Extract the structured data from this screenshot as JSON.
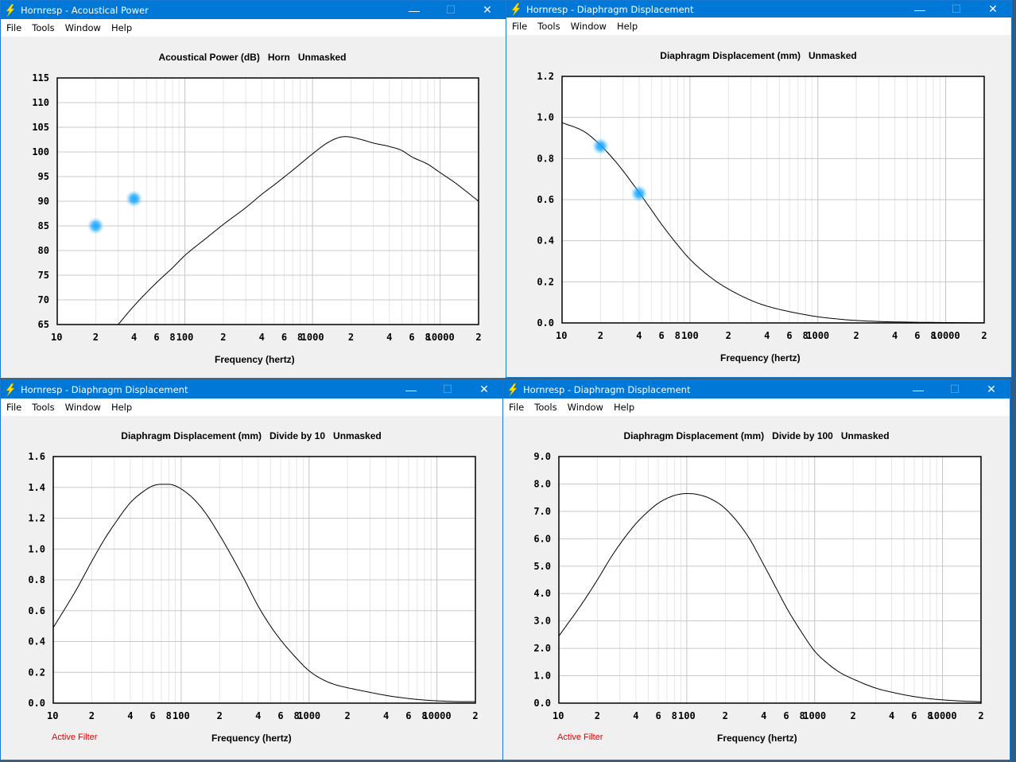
{
  "menu": [
    "File",
    "Tools",
    "Window",
    "Help"
  ],
  "window_controls": {
    "minimize": "—",
    "maximize": "☐",
    "close": "✕"
  },
  "windows": [
    {
      "title": "Hornresp - Acoustical Power",
      "chart_title": "Acoustical Power (dB)   Horn   Unmasked",
      "xlabel": "Frequency (hertz)",
      "footer_note": ""
    },
    {
      "title": "Hornresp - Diaphragm Displacement",
      "chart_title": "Diaphragm Displacement (mm)   Unmasked",
      "xlabel": "Frequency (hertz)",
      "footer_note": ""
    },
    {
      "title": "Hornresp - Diaphragm Displacement",
      "chart_title": "Diaphragm Displacement (mm)   Divide by 10   Unmasked",
      "xlabel": "Frequency (hertz)",
      "footer_note": "Active Filter"
    },
    {
      "title": "Hornresp - Diaphragm Displacement",
      "chart_title": "Diaphragm Displacement (mm)   Divide by 100   Unmasked",
      "xlabel": "Frequency (hertz)",
      "footer_note": "Active Filter"
    }
  ],
  "colors": {
    "titlebar": "#0078d7",
    "curve": "#000000",
    "grid": "#c8c8c8",
    "active_filter": "#e00000",
    "marker": "#1aa7ff"
  },
  "chart_data": [
    {
      "type": "line",
      "title": "Acoustical Power (dB)   Horn   Unmasked",
      "xlabel": "Frequency (hertz)",
      "ylabel": "",
      "xscale": "log",
      "xlim": [
        10,
        20000
      ],
      "ylim": [
        65,
        115
      ],
      "xticks": [
        10,
        20,
        40,
        60,
        80,
        100,
        200,
        400,
        600,
        800,
        1000,
        2000,
        4000,
        6000,
        8000,
        10000,
        20000
      ],
      "xtick_labels": [
        "10",
        "2",
        "4",
        "6",
        "8",
        "100",
        "2",
        "4",
        "6",
        "8",
        "1000",
        "2",
        "4",
        "6",
        "8",
        "10000",
        "2"
      ],
      "yticks": [
        65,
        70,
        75,
        80,
        85,
        90,
        95,
        100,
        105,
        110,
        115
      ],
      "ytick_labels": [
        "65",
        "70",
        "75",
        "80",
        "85",
        "90",
        "95",
        "100",
        "105",
        "110",
        "115"
      ],
      "grid": true,
      "series": [
        {
          "name": "Acoustical Power",
          "x": [
            30,
            40,
            60,
            80,
            100,
            150,
            200,
            300,
            400,
            500,
            700,
            1000,
            1300,
            1600,
            1800,
            2000,
            2500,
            3000,
            4000,
            5000,
            6000,
            8000,
            10000,
            13000,
            16000,
            20000
          ],
          "y": [
            65,
            68.8,
            73.5,
            76.5,
            79,
            82.7,
            85.3,
            88.7,
            91.4,
            93.3,
            96.3,
            99.6,
            101.8,
            102.9,
            103.1,
            103.0,
            102.4,
            101.8,
            101.1,
            100.3,
            99.0,
            97.5,
            95.8,
            93.8,
            92.0,
            90.0
          ]
        }
      ],
      "markers": [
        {
          "x": 20,
          "y": 85
        },
        {
          "x": 40,
          "y": 90.5
        }
      ]
    },
    {
      "type": "line",
      "title": "Diaphragm Displacement (mm)   Unmasked",
      "xlabel": "Frequency (hertz)",
      "xscale": "log",
      "xlim": [
        10,
        20000
      ],
      "ylim": [
        0,
        1.2
      ],
      "xticks": [
        10,
        20,
        40,
        60,
        80,
        100,
        200,
        400,
        600,
        800,
        1000,
        2000,
        4000,
        6000,
        8000,
        10000,
        20000
      ],
      "xtick_labels": [
        "10",
        "2",
        "4",
        "6",
        "8",
        "100",
        "2",
        "4",
        "6",
        "8",
        "1000",
        "2",
        "4",
        "6",
        "8",
        "10000",
        "2"
      ],
      "yticks": [
        0,
        0.2,
        0.4,
        0.6,
        0.8,
        1.0,
        1.2
      ],
      "ytick_labels": [
        "0.0",
        "0.2",
        "0.4",
        "0.6",
        "0.8",
        "1.0",
        "1.2"
      ],
      "grid": true,
      "series": [
        {
          "name": "Diaphragm Displacement",
          "x": [
            10,
            15,
            20,
            25,
            30,
            40,
            50,
            60,
            80,
            100,
            150,
            200,
            300,
            400,
            600,
            800,
            1000,
            1500,
            2000,
            3000,
            5000,
            10000,
            20000
          ],
          "y": [
            0.975,
            0.93,
            0.865,
            0.8,
            0.74,
            0.635,
            0.55,
            0.48,
            0.38,
            0.31,
            0.215,
            0.165,
            0.11,
            0.082,
            0.055,
            0.04,
            0.03,
            0.018,
            0.012,
            0.007,
            0.004,
            0.002,
            0.001
          ]
        }
      ],
      "markers": [
        {
          "x": 20,
          "y": 0.86
        },
        {
          "x": 40,
          "y": 0.63
        }
      ]
    },
    {
      "type": "line",
      "title": "Diaphragm Displacement (mm)   Divide by 10   Unmasked",
      "xlabel": "Frequency (hertz)",
      "xscale": "log",
      "xlim": [
        10,
        20000
      ],
      "ylim": [
        0,
        1.6
      ],
      "xticks": [
        10,
        20,
        40,
        60,
        80,
        100,
        200,
        400,
        600,
        800,
        1000,
        2000,
        4000,
        6000,
        8000,
        10000,
        20000
      ],
      "xtick_labels": [
        "10",
        "2",
        "4",
        "6",
        "8",
        "100",
        "2",
        "4",
        "6",
        "8",
        "1000",
        "2",
        "4",
        "6",
        "8",
        "10000",
        "2"
      ],
      "yticks": [
        0,
        0.2,
        0.4,
        0.6,
        0.8,
        1.0,
        1.2,
        1.4,
        1.6
      ],
      "ytick_labels": [
        "0.0",
        "0.2",
        "0.4",
        "0.6",
        "0.8",
        "1.0",
        "1.2",
        "1.4",
        "1.6"
      ],
      "grid": true,
      "series": [
        {
          "name": "Diaphragm Displacement /10",
          "x": [
            10,
            15,
            20,
            25,
            30,
            40,
            50,
            60,
            70,
            80,
            90,
            100,
            120,
            150,
            200,
            300,
            400,
            500,
            600,
            800,
            1000,
            1300,
            1600,
            2000,
            3000,
            4000,
            6000,
            8000,
            10000,
            15000,
            20000
          ],
          "y": [
            0.49,
            0.73,
            0.92,
            1.06,
            1.16,
            1.3,
            1.37,
            1.41,
            1.42,
            1.42,
            1.41,
            1.39,
            1.34,
            1.25,
            1.09,
            0.83,
            0.63,
            0.5,
            0.41,
            0.29,
            0.21,
            0.15,
            0.12,
            0.1,
            0.07,
            0.05,
            0.03,
            0.02,
            0.015,
            0.01,
            0.01
          ]
        }
      ]
    },
    {
      "type": "line",
      "title": "Diaphragm Displacement (mm)   Divide by 100   Unmasked",
      "xlabel": "Frequency (hertz)",
      "xscale": "log",
      "xlim": [
        10,
        20000
      ],
      "ylim": [
        0,
        9.0
      ],
      "xticks": [
        10,
        20,
        40,
        60,
        80,
        100,
        200,
        400,
        600,
        800,
        1000,
        2000,
        4000,
        6000,
        8000,
        10000,
        20000
      ],
      "xtick_labels": [
        "10",
        "2",
        "4",
        "6",
        "8",
        "100",
        "2",
        "4",
        "6",
        "8",
        "1000",
        "2",
        "4",
        "6",
        "8",
        "10000",
        "2"
      ],
      "yticks": [
        0,
        1,
        2,
        3,
        4,
        5,
        6,
        7,
        8,
        9
      ],
      "ytick_labels": [
        "0.0",
        "1.0",
        "2.0",
        "3.0",
        "4.0",
        "5.0",
        "6.0",
        "7.0",
        "8.0",
        "9.0"
      ],
      "grid": true,
      "series": [
        {
          "name": "Diaphragm Displacement /100",
          "x": [
            10,
            15,
            20,
            25,
            30,
            40,
            50,
            60,
            80,
            100,
            120,
            150,
            200,
            300,
            400,
            500,
            600,
            800,
            1000,
            1300,
            1600,
            2000,
            3000,
            4000,
            6000,
            8000,
            10000,
            15000,
            20000
          ],
          "y": [
            2.45,
            3.6,
            4.5,
            5.25,
            5.8,
            6.55,
            7.0,
            7.3,
            7.58,
            7.65,
            7.62,
            7.48,
            7.1,
            6.1,
            5.05,
            4.2,
            3.5,
            2.55,
            1.9,
            1.4,
            1.1,
            0.88,
            0.55,
            0.4,
            0.24,
            0.16,
            0.12,
            0.07,
            0.05
          ]
        }
      ]
    }
  ]
}
